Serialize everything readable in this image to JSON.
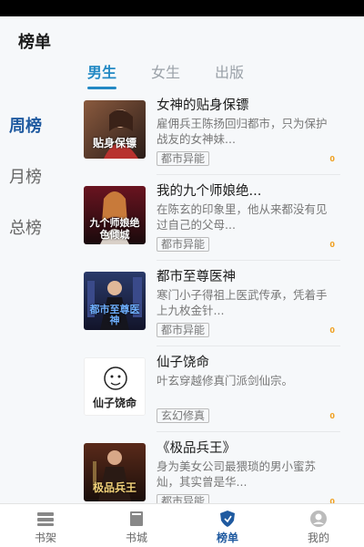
{
  "page": {
    "title": "榜单"
  },
  "tabs": [
    {
      "label": "男生",
      "active": true
    },
    {
      "label": "女生",
      "active": false
    },
    {
      "label": "出版",
      "active": false
    }
  ],
  "side_nav": [
    {
      "label": "周榜",
      "active": true
    },
    {
      "label": "月榜",
      "active": false
    },
    {
      "label": "总榜",
      "active": false
    }
  ],
  "books": [
    {
      "title": "女神的贴身保镖",
      "desc": "雇佣兵王陈扬回归都市，只为保护战友的女神妹...",
      "tag": "都市异能",
      "badge": "0",
      "cover_text": "贴身保镖"
    },
    {
      "title": "我的九个师娘绝...",
      "desc": "在陈玄的印象里，他从来都没有见过自己的父母...",
      "tag": "都市异能",
      "badge": "0",
      "cover_text": "九个师娘绝色倾城"
    },
    {
      "title": "都市至尊医神",
      "desc": "寒门小子得祖上医武传承，凭着手上九枚金针...",
      "tag": "都市异能",
      "badge": "0",
      "cover_text": "都市至尊医神"
    },
    {
      "title": "仙子饶命",
      "desc": "叶玄穿越修真门派剑仙宗。",
      "tag": "玄幻修真",
      "badge": "0",
      "cover_text": "仙子饶命"
    },
    {
      "title": "《极品兵王》",
      "desc": "身为美女公司最猥琐的男小蜜苏灿，其实曾是华...",
      "tag": "都市异能",
      "badge": "0",
      "cover_text": "极品兵王"
    }
  ],
  "tabbar": [
    {
      "label": "书架",
      "icon": "bookshelf-icon",
      "active": false
    },
    {
      "label": "书城",
      "icon": "book-icon",
      "active": false
    },
    {
      "label": "榜单",
      "icon": "ranking-shield-icon",
      "active": true
    },
    {
      "label": "我的",
      "icon": "user-icon",
      "active": false
    }
  ],
  "colors": {
    "accent": "#2389c4",
    "nav_active": "#1f5aa0",
    "badge": "#f0a021",
    "background": "#f6f8fa"
  }
}
